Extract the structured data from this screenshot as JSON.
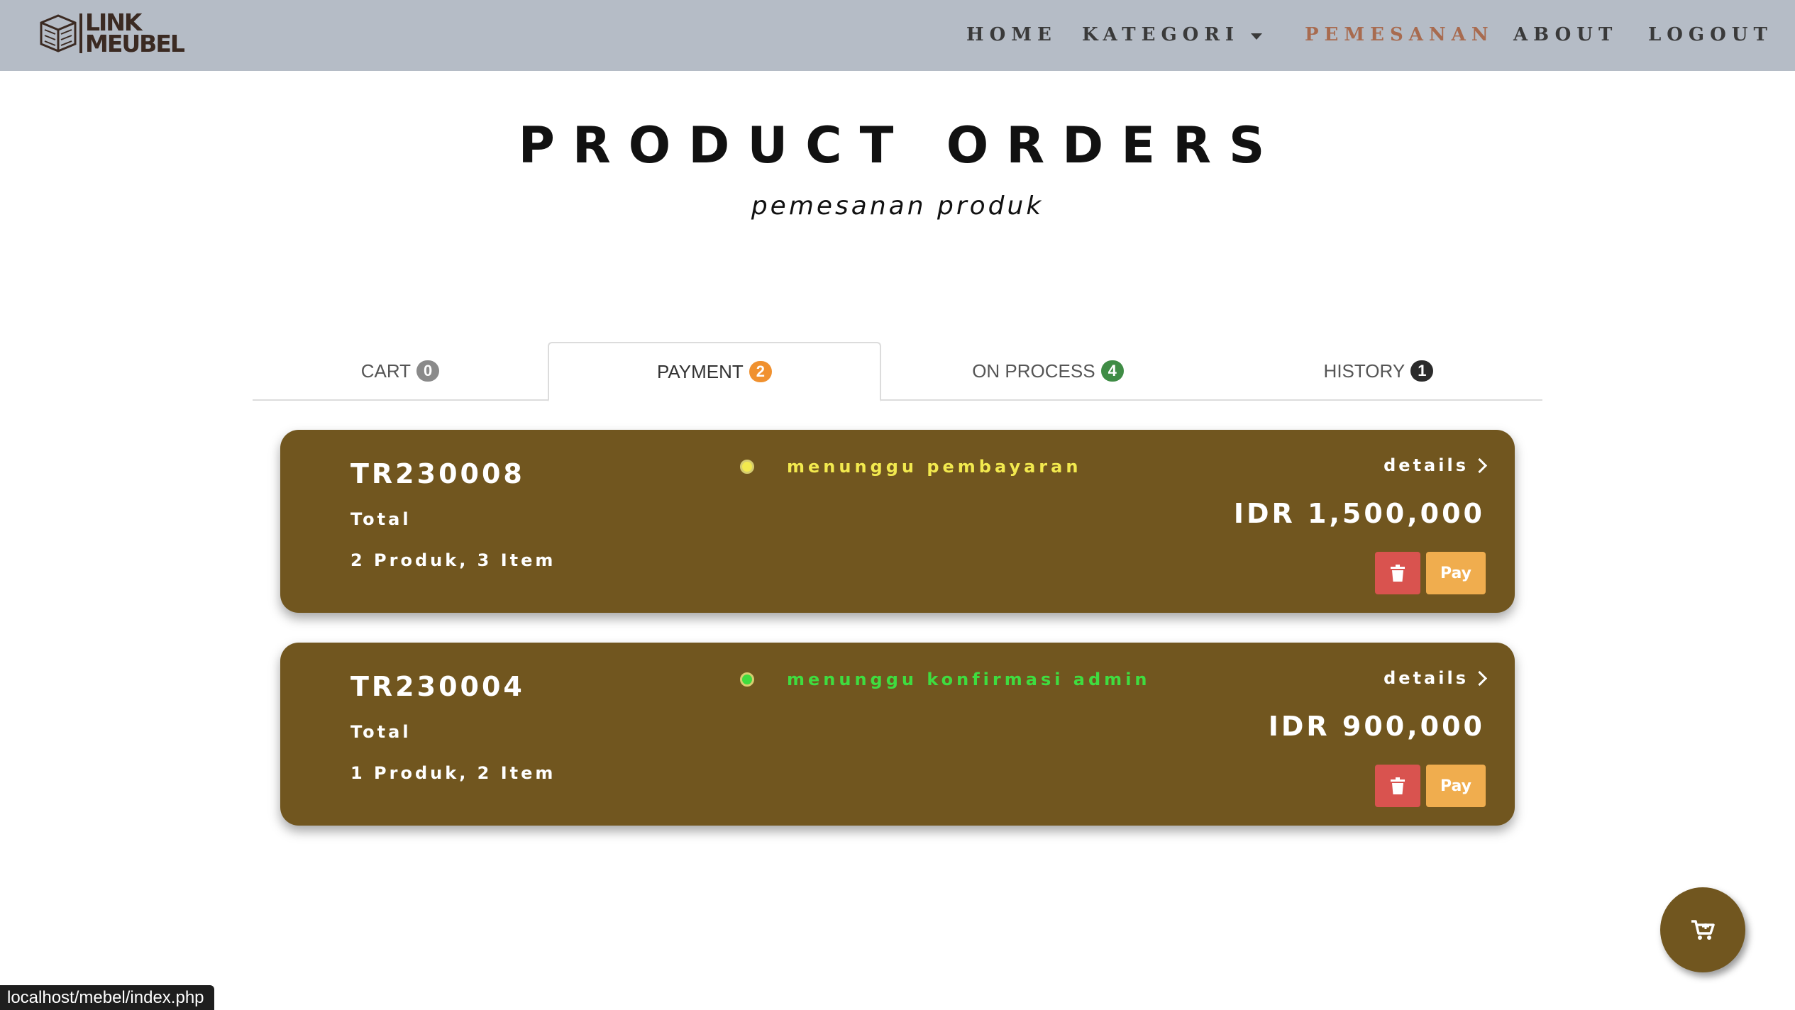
{
  "brand": {
    "line1": "LINK",
    "line2": "MEUBEL"
  },
  "nav": {
    "home": "HOME",
    "kategori": "KATEGORI",
    "pemesanan": "PEMESANAN",
    "about": "ABOUT",
    "logout": "LOGOUT",
    "active": "PEMESANAN",
    "active_color": "#a86b4f"
  },
  "page": {
    "title": "PRODUCT ORDERS",
    "subtitle": "pemesanan produk"
  },
  "tabs": [
    {
      "label": "CART",
      "count": "0",
      "badge_color": "#8a8a8a"
    },
    {
      "label": "PAYMENT",
      "count": "2",
      "badge_color": "#f0912f",
      "active": true
    },
    {
      "label": "ON PROCESS",
      "count": "4",
      "badge_color": "#3f8c45"
    },
    {
      "label": "HISTORY",
      "count": "1",
      "badge_color": "#2b2b2b"
    }
  ],
  "orders": [
    {
      "id": "TR230008",
      "total_label": "Total",
      "items": "2 Produk, 3 Item",
      "status": "menunggu pembayaran",
      "status_color": "#f2e94e",
      "details": "details",
      "price": "IDR 1,500,000",
      "pay_label": "Pay"
    },
    {
      "id": "TR230004",
      "total_label": "Total",
      "items": "1 Produk, 2 Item",
      "status": "menunggu konfirmasi admin",
      "status_color": "#3fdc3f",
      "details": "details",
      "price": "IDR 900,000",
      "pay_label": "Pay"
    }
  ],
  "colors": {
    "navbar_bg": "#b5bcc6",
    "card_bg": "#71561f",
    "delete_btn": "#d9534f",
    "pay_btn": "#f0ad4e"
  },
  "icons": {
    "delete": "trash-icon",
    "details": "chevron-right-icon",
    "floating": "cart-icon",
    "kategori_dropdown": "caret-down-icon"
  },
  "status_bar": {
    "url": "localhost/mebel/index.php"
  }
}
